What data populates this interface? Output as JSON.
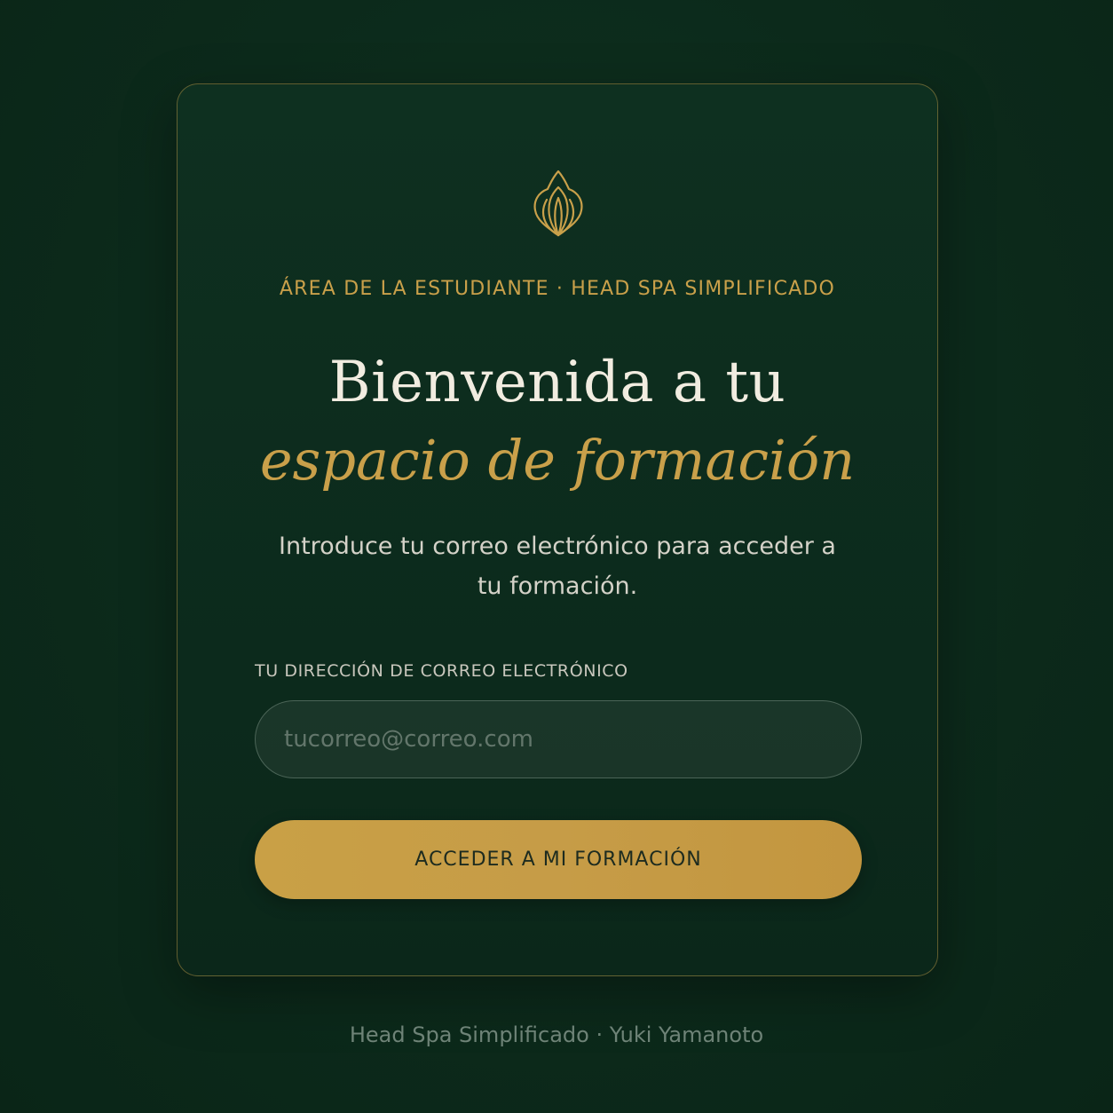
{
  "brand": {
    "logo_icon": "lotus-icon",
    "accent_color": "#c9a04a",
    "background_color": "#0c2a1b"
  },
  "card": {
    "eyebrow": "ÁREA DE LA ESTUDIANTE · HEAD SPA SIMPLIFICADO",
    "title_line1": "Bienvenida a tu",
    "title_line2": "espacio de formación",
    "subtitle": "Introduce tu correo electrónico para acceder a tu formación."
  },
  "form": {
    "email_label": "TU DIRECCIÓN DE CORREO ELECTRÓNICO",
    "email_placeholder": "tucorreo@correo.com",
    "email_value": "",
    "submit_label": "ACCEDER A MI FORMACIÓN"
  },
  "footer": {
    "text": "Head Spa Simplificado · Yuki Yamanoto"
  }
}
